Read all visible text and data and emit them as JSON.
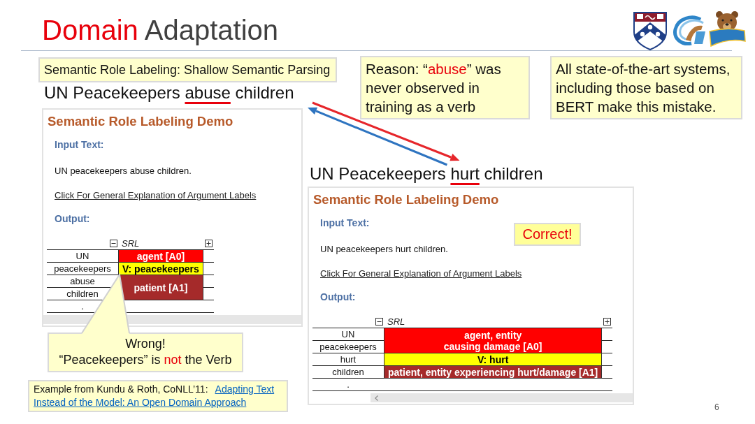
{
  "title": [
    {
      "text": "Domain ",
      "highlight": true
    },
    {
      "text": "Adaptation",
      "highlight": false
    }
  ],
  "topic": "Semantic Role Labeling: Shallow Semantic Parsing",
  "notes": [
    [
      {
        "text": "Reason: “",
        "highlight": false
      },
      {
        "text": "abuse",
        "highlight": true
      },
      {
        "text": "” was never observed in training as a verb",
        "highlight": false
      }
    ],
    [
      {
        "text": "All state-of-the-art systems, including those based on BERT make this mistake.",
        "highlight": false
      }
    ]
  ],
  "demos": [
    {
      "sentence": [
        {
          "text": "UN Peacekeepers ",
          "underlined": false
        },
        {
          "text": "abuse",
          "underlined": true
        },
        {
          "text": " children",
          "underlined": false
        }
      ],
      "title": "Semantic Role Labeling Demo",
      "input_label": "Input Text:",
      "input_text": "UN peacekeepers abuse children.",
      "link": "Click For General Explanation of Argument Labels",
      "output_label": "Output:",
      "table": {
        "header": "SRL",
        "groups": [
          {
            "words": [
              "UN"
            ],
            "role": {
              "label": "agent [A0]",
              "kind": "argument",
              "color": "#ff0000"
            }
          },
          {
            "words": [
              "peacekeepers"
            ],
            "role": {
              "label": "V: peacekeepers",
              "kind": "verb",
              "color": "#ffff00"
            }
          },
          {
            "words": [
              "abuse",
              "children"
            ],
            "role": {
              "label": "patient [A1]",
              "kind": "argument",
              "color": "#a52a2a"
            }
          },
          {
            "words": [
              "."
            ]
          }
        ]
      }
    },
    {
      "sentence": [
        {
          "text": "UN Peacekeepers ",
          "underlined": false
        },
        {
          "text": "hurt",
          "underlined": true
        },
        {
          "text": " children",
          "underlined": false
        }
      ],
      "title": "Semantic Role Labeling Demo",
      "input_label": "Input Text:",
      "input_text": "UN peacekeepers hurt children.",
      "link": "Click For General Explanation of Argument Labels",
      "output_label": "Output:",
      "verdict": "Correct!",
      "table": {
        "header": "SRL",
        "groups": [
          {
            "words": [
              "UN",
              "peacekeepers"
            ],
            "role": {
              "label": "agent, entity\ncausing damage [A0]",
              "kind": "argument",
              "color": "#ff0000"
            }
          },
          {
            "words": [
              "hurt"
            ],
            "role": {
              "label": "V: hurt",
              "kind": "verb",
              "color": "#ffff00"
            }
          },
          {
            "words": [
              "children"
            ],
            "role": {
              "label": "patient, entity experiencing hurt/damage [A1]",
              "kind": "argument",
              "color": "#a52a2a"
            }
          },
          {
            "words": [
              "."
            ]
          }
        ]
      }
    }
  ],
  "callout": {
    "lines": [
      [
        {
          "text": "Wrong!",
          "highlight": false
        }
      ],
      [
        {
          "text": "“Peacekeepers” is ",
          "highlight": false
        },
        {
          "text": "not",
          "highlight": true
        },
        {
          "text": " the Verb",
          "highlight": false
        }
      ]
    ]
  },
  "citation": {
    "text": "Example from Kundu & Roth, CoNLL’11:",
    "link_lines": [
      "Adapting Text",
      "Instead of the Model: An Open Domain Approach"
    ]
  },
  "page_number": "6"
}
